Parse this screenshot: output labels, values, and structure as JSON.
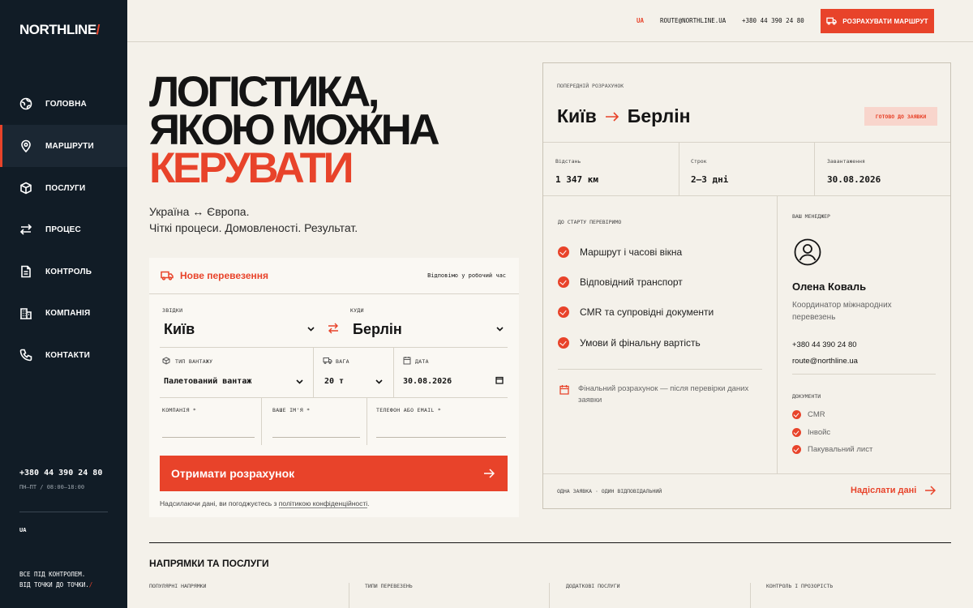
{
  "brand": {
    "name": "NORTHLINE",
    "slash": "/"
  },
  "sidebar": {
    "items": [
      {
        "label": "ГОЛОВНА",
        "icon": "globe-icon"
      },
      {
        "label": "МАРШРУТИ",
        "icon": "pin-icon"
      },
      {
        "label": "ПОСЛУГИ",
        "icon": "box-icon"
      },
      {
        "label": "ПРОЦЕС",
        "icon": "arrows-icon"
      },
      {
        "label": "КОНТРОЛЬ",
        "icon": "doc-icon"
      },
      {
        "label": "КОМПАНІЯ",
        "icon": "building-icon"
      },
      {
        "label": "КОНТАКТИ",
        "icon": "phone-icon"
      }
    ],
    "active_index": 1,
    "phone": "+380 44 390 24 80",
    "hours": "ПН–ПТ / 08:00–18:00",
    "lang": "UA",
    "motto_line1": "ВСЕ ПІД КОНТРОЛЕМ.",
    "motto_line2": "ВІД ТОЧКИ ДО ТОЧКИ.",
    "motto_slash": "/"
  },
  "topbar": {
    "lang": "UA",
    "email": "ROUTE@NORTHLINE.UA",
    "phone": "+380 44 390 24 80",
    "cta": "РОЗРАХУВАТИ МАРШРУТ"
  },
  "hero": {
    "line1": "ЛОГІСТИКА,",
    "line2": "ЯКОЮ МОЖНА",
    "line3": "КЕРУВАТИ",
    "sub1": "Україна ↔ Європа.",
    "sub2": "Чіткі процеси. Домовленості. Результат."
  },
  "form": {
    "title": "Нове перевезення",
    "hint": "Відповімо у робочий час",
    "from_label": "ЗВІДКИ",
    "from_value": "Київ",
    "to_label": "КУДИ",
    "to_value": "Берлін",
    "cargo_label": "ТИП ВАНТАЖУ",
    "cargo_value": "Палетований вантаж",
    "weight_label": "ВАГА",
    "weight_value": "20 т",
    "date_label": "ДАТА",
    "date_value": "30.08.2026",
    "company_label": "КОМПАНІЯ *",
    "name_label": "ВАШЕ ІМ'Я *",
    "contact_label": "ТЕЛЕФОН АБО EMAIL *",
    "submit": "Отримати розрахунок",
    "consent_text": "Надсилаючи дані, ви погоджуєтесь з ",
    "consent_link": "політикою конфіденційності",
    "consent_end": "."
  },
  "card": {
    "kicker": "ПОПЕРЕДНІЙ РОЗРАХУНОК",
    "from": "Київ",
    "to": "Берлін",
    "status": "ГОТОВО ДО ЗАЯВКИ",
    "stats": [
      {
        "label": "Відстань",
        "value": "1 347 км"
      },
      {
        "label": "Строк",
        "value": "2–3 дні"
      },
      {
        "label": "Завантаження",
        "value": "30.08.2026"
      }
    ],
    "check_kicker": "ДО СТАРТУ ПЕРЕВІРИМО",
    "checks": [
      "Маршрут і часові вікна",
      "Відповідний транспорт",
      "CMR та супровідні документи",
      "Умови й фінальну вартість"
    ],
    "final_note": "Фінальний розрахунок — після перевірки даних заявки",
    "manager_kicker": "ВАШ МЕНЕДЖЕР",
    "manager_name": "Олена Коваль",
    "manager_role": "Координатор міжнародних перевезень",
    "manager_phone": "+380 44 390 24 80",
    "manager_email": "route@northline.ua",
    "docs_kicker": "ДОКУМЕНТИ",
    "docs": [
      "CMR",
      "Інвойс",
      "Пакувальний лист"
    ],
    "foot_left": "ОДНА ЗАЯВКА · ОДИН ВІДПОВІДАЛЬНИЙ",
    "foot_right": "Надіслати дані"
  },
  "bottom": {
    "title": "НАПРЯМКИ ТА ПОСЛУГИ",
    "cols": [
      "ПОПУЛЯРНІ НАПРЯМКИ",
      "ТИПИ ПЕРЕВЕЗЕНЬ",
      "ДОДАТКОВІ ПОСЛУГИ",
      "КОНТРОЛЬ І ПРОЗОРІСТЬ"
    ]
  },
  "colors": {
    "accent": "#e8432a",
    "sidebar": "#111c26",
    "background": "#f4f1ea"
  }
}
